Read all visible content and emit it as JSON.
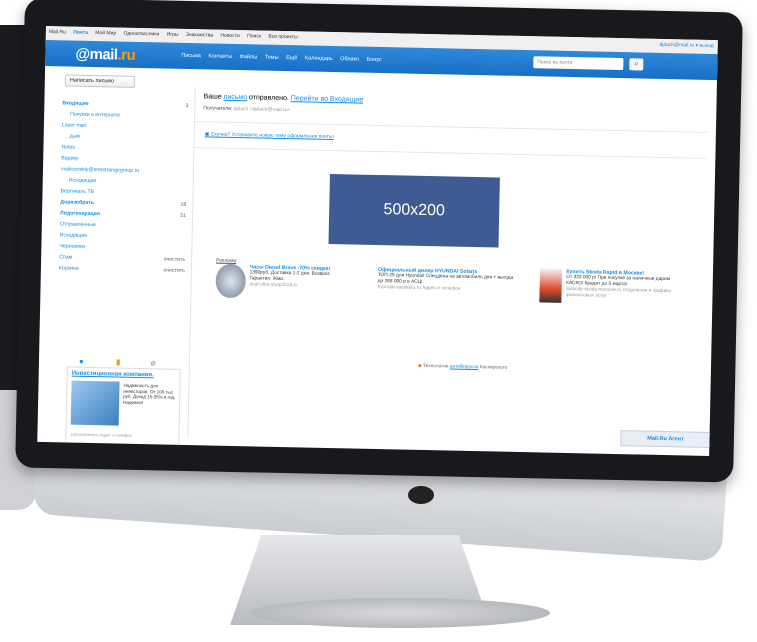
{
  "topbar": {
    "links": [
      "Mail.Ru",
      "Почта",
      "Мой Мир",
      "Одноклассники",
      "Игры",
      "Знакомства",
      "Новости",
      "Поиск",
      "Все проекты"
    ],
    "user": "dplach@mail.ru ▾  выход"
  },
  "header": {
    "logo_at": "@",
    "logo_mail": "mail",
    "logo_dot": ".",
    "logo_ru": "ru",
    "nav": [
      "Письма",
      "Контакты",
      "Файлы",
      "Темы",
      "Ещё",
      "Календарь",
      "Облако",
      "Бонус"
    ],
    "search_placeholder": "Поиск по почте",
    "search_icon": "search-icon"
  },
  "toolbar": {
    "compose_label": "Написать письмо"
  },
  "sidebar": {
    "folders": [
      {
        "label": "Входящие",
        "count": "3",
        "bold": true
      },
      {
        "label": "Покупки в интернете",
        "count": ""
      },
      {
        "label": "Laser man",
        "count": ""
      },
      {
        "label": "дым",
        "count": ""
      },
      {
        "label": "Notes",
        "count": ""
      },
      {
        "label": "Вадику",
        "count": ""
      },
      {
        "label": "vvalicevskiy@streetrangegroup.ru",
        "count": ""
      },
      {
        "label": "Исходящие",
        "count": ""
      },
      {
        "label": "Вертикаль ТВ",
        "count": ""
      },
      {
        "label": "Доразобрать",
        "count": "18",
        "bold": true
      },
      {
        "label": "Лидогенерация",
        "count": "51",
        "bold": true
      },
      {
        "label": "Отправленные",
        "count": ""
      },
      {
        "label": "Исходящие",
        "count": ""
      },
      {
        "label": "Черновики",
        "count": ""
      },
      {
        "label": "Спам",
        "count": "очистить"
      },
      {
        "label": "Корзина",
        "count": "очистить"
      }
    ],
    "ad": {
      "title": "Инвестиционная компания.",
      "text": "Надежность для инвесторов. От 100 тыс руб. Доход 15-35% в год. Надежно!",
      "source": "x3investment.ru   Адрес и телефон"
    }
  },
  "main": {
    "sent_prefix": "Ваше",
    "sent_link": "письмо",
    "sent_suffix": "отправлено.",
    "sent_go": "Перейти во Входящие",
    "recipient_label": "Получатели:",
    "recipient_value": "dplach <dplach@mail.ru>",
    "theme_link": "Скучно? Установите новую тему оформления почты!",
    "banner_text": "500x200",
    "ad_label": "Реклама",
    "ads": [
      {
        "title": "Часы Diesel Brave -70% скидка!",
        "text": "1390руб. Доставка 1-2 дня. Возврат. Гарантия. Жми.",
        "source": "dual-ultra-shop2018.ru"
      },
      {
        "title": "Официальный дилер HYUNDAI Solaris",
        "text": "ТОП-25 для Hyundai! Спецдена на автомобиль дня + выгода до 268 000 р в АСЦ!",
        "source": "hyundai-sasbesto.ru   Адрес и телефон"
      },
      {
        "title": "Купить Skoda Rapid в Москве!",
        "text": "От 333 000 р! При покупке за наличные дарим КАСКО! Кредит до 5 марта!",
        "source": "autocity-skoda-moscow.ru   Отделения и графики финансовых услуг"
      }
    ],
    "footer_prefix": "Технологии",
    "footer_link": "антиВирусов",
    "footer_suffix": "Касперского",
    "agent_label": "Mail.Ru Агент"
  },
  "colors": {
    "header": "#1f7bd1",
    "accent": "#168de2",
    "banner": "#3f5b93"
  }
}
